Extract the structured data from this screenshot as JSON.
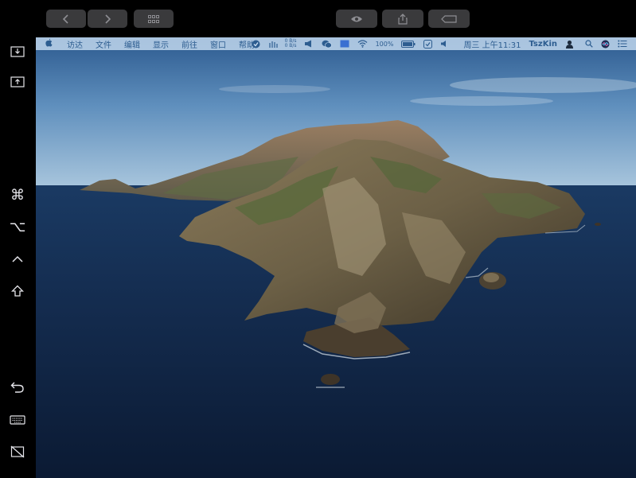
{
  "toolbar": {
    "buttons": [
      {
        "name": "back-button",
        "icon": "chevron-left-icon"
      },
      {
        "name": "forward-button",
        "icon": "chevron-right-icon"
      },
      {
        "name": "grid-button",
        "icon": "grid-icon"
      },
      {
        "name": "view-button",
        "icon": "eye-icon"
      },
      {
        "name": "share-button",
        "icon": "share-icon"
      },
      {
        "name": "keyboard-toggle-button",
        "icon": "tag-icon"
      }
    ],
    "background_color": "#000000",
    "button_color": "#3a3a3c"
  },
  "sidebar": {
    "icons": [
      "download-screen-icon",
      "upload-screen-icon",
      "command-key-icon",
      "option-key-icon",
      "control-key-icon",
      "shift-key-icon",
      "undo-icon",
      "keyboard-icon",
      "disconnect-screen-icon"
    ]
  },
  "menubar": {
    "apple": "",
    "menus": [
      "访达",
      "文件",
      "编辑",
      "显示",
      "前往",
      "窗口",
      "帮助"
    ],
    "net_up": "0 B/s",
    "net_down": "0 B/s",
    "battery": "100%",
    "clock": "周三 上午11:31",
    "user": "TszKin",
    "text_color": "#2d5d90",
    "background_color": "#cde1f5"
  }
}
